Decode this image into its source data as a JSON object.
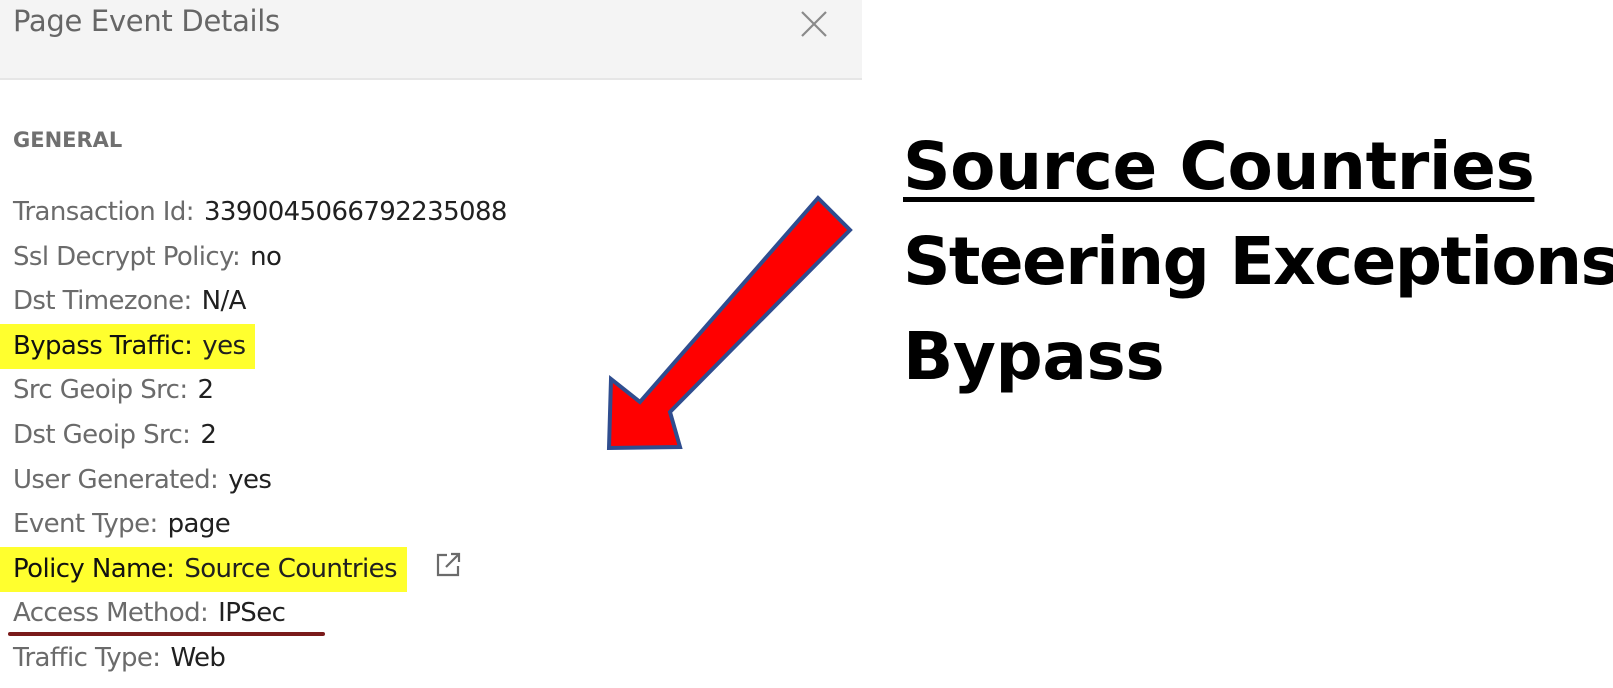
{
  "panel": {
    "title": "Page Event Details",
    "section_title": "GENERAL",
    "rows": [
      {
        "key": "Transaction Id:",
        "value": "3390045066792235088"
      },
      {
        "key": "Ssl Decrypt Policy:",
        "value": "no"
      },
      {
        "key": "Dst Timezone:",
        "value": "N/A"
      },
      {
        "key": "Bypass Traffic:",
        "value": "yes"
      },
      {
        "key": "Src Geoip Src:",
        "value": "2"
      },
      {
        "key": "Dst Geoip Src:",
        "value": "2"
      },
      {
        "key": "User Generated:",
        "value": "yes"
      },
      {
        "key": "Event Type:",
        "value": "page"
      },
      {
        "key": "Policy Name:",
        "value": "Source Countries"
      },
      {
        "key": "Access Method:",
        "value": "IPSec"
      },
      {
        "key": "Traffic Type:",
        "value": "Web"
      }
    ]
  },
  "annotation": {
    "line1": "Source Countries",
    "line2": "Steering Exceptions",
    "line3": "Bypass"
  },
  "icons": {
    "close": "close-icon",
    "external_link": "external-link-icon"
  },
  "colors": {
    "highlight": "#ffff2e",
    "arrow_fill": "#ff0000",
    "arrow_stroke": "#2f4d8f",
    "underline": "#7a1a1a",
    "header_bg": "#f4f4f4"
  }
}
